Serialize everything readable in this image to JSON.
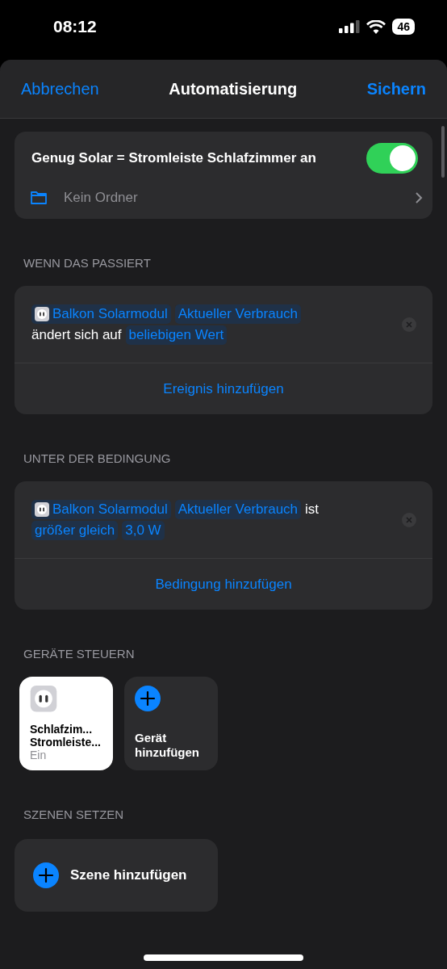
{
  "status_bar": {
    "time": "08:12",
    "battery": "46"
  },
  "nav": {
    "cancel": "Abbrechen",
    "title": "Automatisierung",
    "save": "Sichern"
  },
  "automation": {
    "name": "Genug Solar = Stromleiste Schlafzimmer an",
    "enabled": true,
    "folder": "Kein Ordner"
  },
  "sections": [
    {
      "header": "WENN DAS PASSIERT",
      "clause": [
        {
          "kind": "device",
          "text": "Balkon Solarmodul"
        },
        {
          "kind": "token",
          "text": "Aktueller Verbrauch"
        },
        {
          "kind": "text",
          "text": "ändert sich auf"
        },
        {
          "kind": "token",
          "text": "beliebigen Wert"
        }
      ],
      "add": "Ereignis hinzufügen"
    },
    {
      "header": "UNTER DER BEDINGUNG",
      "clause": [
        {
          "kind": "device",
          "text": "Balkon Solarmodul"
        },
        {
          "kind": "token",
          "text": "Aktueller Verbrauch"
        },
        {
          "kind": "text",
          "text": "ist"
        },
        {
          "kind": "token",
          "text": "größer gleich"
        },
        {
          "kind": "token",
          "text": "3,0 W"
        }
      ],
      "add": "Bedingung hinzufügen"
    }
  ],
  "devices": {
    "header": "GERÄTE STEUERN",
    "tiles": [
      {
        "kind": "device",
        "lines": [
          "Schlafzim...",
          "Stromleiste..."
        ],
        "status": "Ein",
        "on": true
      },
      {
        "kind": "add",
        "lines": [
          "Gerät",
          "hinzufügen"
        ]
      }
    ]
  },
  "scenes": {
    "header": "SZENEN SETZEN",
    "add": "Szene hinzufügen"
  }
}
